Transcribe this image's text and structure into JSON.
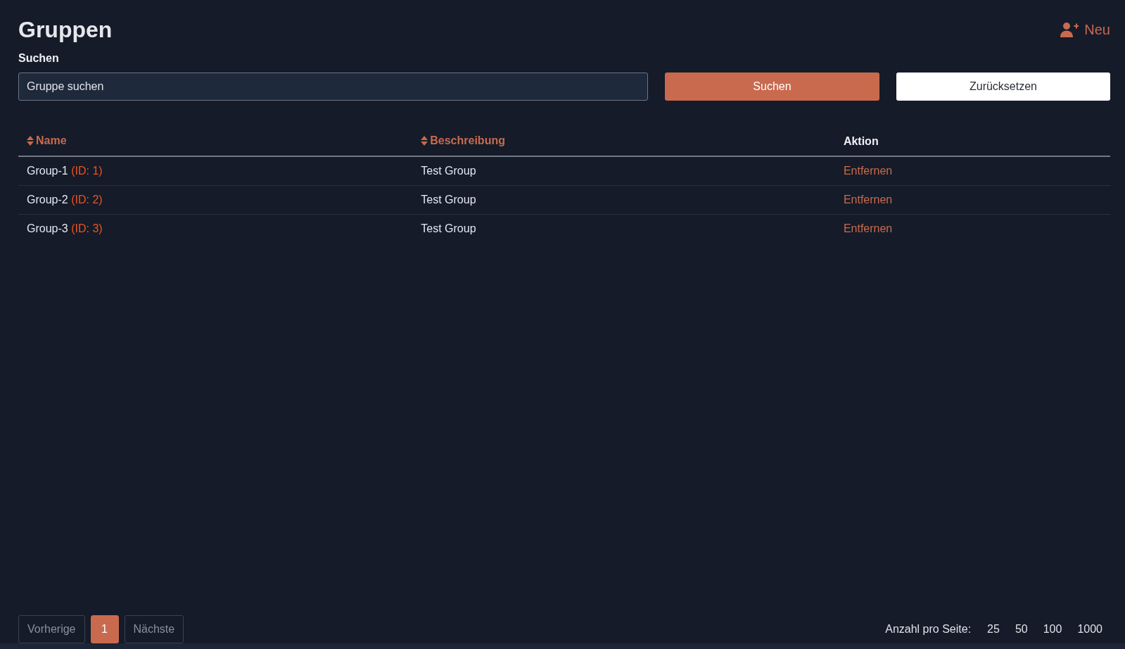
{
  "page": {
    "title": "Gruppen",
    "new_button": "Neu"
  },
  "search": {
    "label": "Suchen",
    "placeholder": "Gruppe suchen",
    "submit": "Suchen",
    "reset": "Zurücksetzen"
  },
  "table": {
    "columns": [
      {
        "label": "Name",
        "sortable": true
      },
      {
        "label": "Beschreibung",
        "sortable": true
      },
      {
        "label": "Aktion",
        "sortable": false
      }
    ],
    "rows": [
      {
        "name": "Group-1",
        "id": "(ID: 1)",
        "description": "Test Group",
        "action": "Entfernen"
      },
      {
        "name": "Group-2",
        "id": "(ID: 2)",
        "description": "Test Group",
        "action": "Entfernen"
      },
      {
        "name": "Group-3",
        "id": "(ID: 3)",
        "description": "Test Group",
        "action": "Entfernen"
      }
    ]
  },
  "pagination": {
    "previous": {
      "label": "Vorherige",
      "disabled": true
    },
    "pages": [
      {
        "label": "1",
        "selected": true
      }
    ],
    "next": {
      "label": "Nächste",
      "disabled": true
    }
  },
  "page_size": {
    "label": "Anzahl pro Seite:",
    "options": [
      "25",
      "50",
      "100",
      "1000"
    ]
  }
}
